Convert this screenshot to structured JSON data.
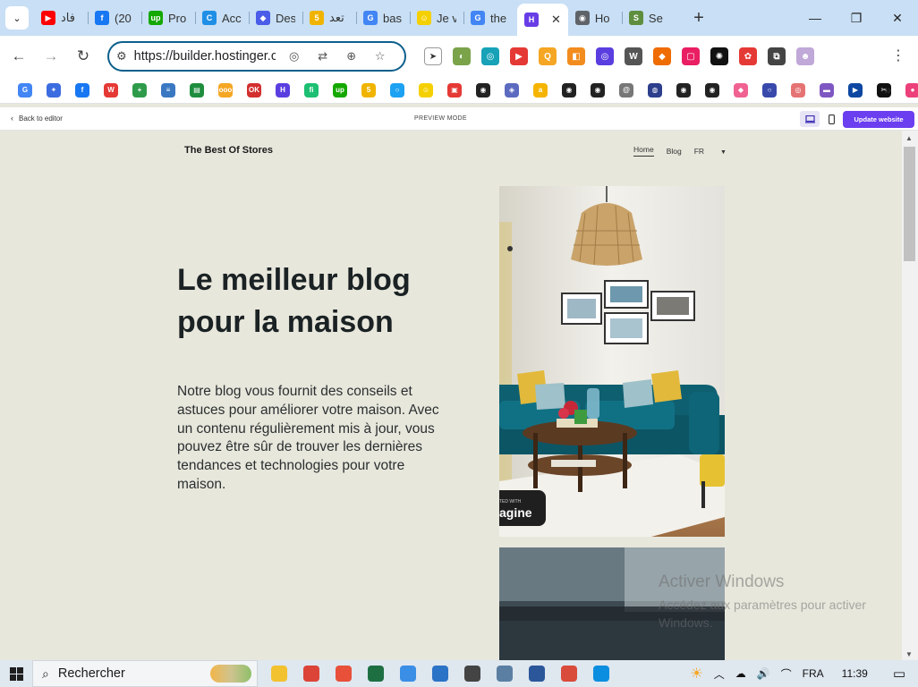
{
  "browser": {
    "tabs": [
      {
        "title": "فاد",
        "fav": "youtube-icon",
        "color": "#ff0000",
        "glyph": "▶"
      },
      {
        "title": "(20",
        "fav": "facebook-icon",
        "color": "#1877f2",
        "glyph": "f"
      },
      {
        "title": "Pro",
        "fav": "upwork-icon",
        "color": "#14a800",
        "glyph": "up"
      },
      {
        "title": "Acc",
        "fav": "canva-icon",
        "color": "#1f8fe6",
        "glyph": "C"
      },
      {
        "title": "Des",
        "fav": "designer-icon",
        "color": "#4a5ce8",
        "glyph": "◆"
      },
      {
        "title": "تعد",
        "fav": "five-icon",
        "color": "#f0b400",
        "glyph": "5"
      },
      {
        "title": "bas",
        "fav": "google-icon",
        "color": "#4285f4",
        "glyph": "G"
      },
      {
        "title": "Je v",
        "fav": "emoji-icon",
        "color": "#f5d000",
        "glyph": "☺"
      },
      {
        "title": "the",
        "fav": "google-icon",
        "color": "#4285f4",
        "glyph": "G"
      },
      {
        "title": "",
        "fav": "hostinger-icon",
        "color": "#673de6",
        "glyph": "H",
        "active": true
      },
      {
        "title": "Ho",
        "fav": "globe-icon",
        "color": "#5f6368",
        "glyph": "◉"
      },
      {
        "title": "Se",
        "fav": "shopify-icon",
        "color": "#5e8e3e",
        "glyph": "S"
      }
    ],
    "new_tab": "+",
    "window_controls": {
      "minimize": "—",
      "restore": "❐",
      "close": "✕"
    },
    "tab_search": "⌄"
  },
  "address_bar": {
    "url": "https://builder.hostinger.c",
    "back": "←",
    "forward": "→",
    "reload": "↻"
  },
  "extensions": [
    {
      "name": "cursor-ext-icon",
      "color": "#ffffff",
      "glyph": "➤",
      "outline": true
    },
    {
      "name": "glasses-ext-icon",
      "color": "#7aa34a",
      "glyph": "◐"
    },
    {
      "name": "robot-ext-icon",
      "color": "#17a2b8",
      "glyph": "◎"
    },
    {
      "name": "record-ext-icon",
      "color": "#e53935",
      "glyph": "▶"
    },
    {
      "name": "search-ext-icon",
      "color": "#f5a623",
      "glyph": "Q"
    },
    {
      "name": "box-ext-icon",
      "color": "#f28c1e",
      "glyph": "◧"
    },
    {
      "name": "ring-ext-icon",
      "color": "#5b3ee0",
      "glyph": "◎"
    },
    {
      "name": "w-ext-icon",
      "color": "#555555",
      "glyph": "W"
    },
    {
      "name": "fire-ext-icon",
      "color": "#ef6c00",
      "glyph": "◆"
    },
    {
      "name": "frame-ext-icon",
      "color": "#e91e63",
      "glyph": "▢"
    },
    {
      "name": "chatgpt-ext-icon",
      "color": "#111111",
      "glyph": "✺"
    },
    {
      "name": "spiral-ext-icon",
      "color": "#e53935",
      "glyph": "✿"
    },
    {
      "name": "puzzle-ext-icon",
      "color": "#444444",
      "glyph": "⧉"
    },
    {
      "name": "profile-avatar-icon",
      "color": "#c0a8d8",
      "glyph": "☻"
    }
  ],
  "bookmarks": [
    {
      "name": "google-bm-icon",
      "color": "#4285f4",
      "glyph": "G"
    },
    {
      "name": "gemini-bm-icon",
      "color": "#3b6ce0",
      "glyph": "✦"
    },
    {
      "name": "facebook-bm-icon",
      "color": "#1877f2",
      "glyph": "f"
    },
    {
      "name": "w-bm-icon",
      "color": "#e53935",
      "glyph": "W"
    },
    {
      "name": "plus-bm-icon",
      "color": "#2e9b4a",
      "glyph": "+"
    },
    {
      "name": "stats-bm-icon",
      "color": "#3a78c2",
      "glyph": "≡"
    },
    {
      "name": "sheet-bm-icon",
      "color": "#1e8e3e",
      "glyph": "▤"
    },
    {
      "name": "ooo-bm-icon",
      "color": "#f5a623",
      "glyph": "ooo"
    },
    {
      "name": "ok-bm-icon",
      "color": "#d32f2f",
      "glyph": "OK"
    },
    {
      "name": "hub-bm-icon",
      "color": "#5b3ee0",
      "glyph": "H"
    },
    {
      "name": "fiverr-bm-icon",
      "color": "#1dbf73",
      "glyph": "fi"
    },
    {
      "name": "upwork-bm-icon",
      "color": "#14a800",
      "glyph": "up"
    },
    {
      "name": "five-bm-icon",
      "color": "#f0b400",
      "glyph": "5"
    },
    {
      "name": "circle-bm-icon",
      "color": "#1da1f2",
      "glyph": "○"
    },
    {
      "name": "emoji-bm-icon",
      "color": "#f5d000",
      "glyph": "☺"
    },
    {
      "name": "gift-bm-icon",
      "color": "#e53935",
      "glyph": "▣"
    },
    {
      "name": "globe-bm-icon",
      "color": "#222222",
      "glyph": "◉"
    },
    {
      "name": "shield-bm-icon",
      "color": "#5c6bc0",
      "glyph": "◈"
    },
    {
      "name": "amazon-bm-icon",
      "color": "#f5b400",
      "glyph": "a"
    },
    {
      "name": "globe2-bm-icon",
      "color": "#222222",
      "glyph": "◉"
    },
    {
      "name": "globe3-bm-icon",
      "color": "#222222",
      "glyph": "◉"
    },
    {
      "name": "at-bm-icon",
      "color": "#777777",
      "glyph": "@"
    },
    {
      "name": "compass-bm-icon",
      "color": "#2c3e8c",
      "glyph": "◍"
    },
    {
      "name": "globe4-bm-icon",
      "color": "#222222",
      "glyph": "◉"
    },
    {
      "name": "globe5-bm-icon",
      "color": "#222222",
      "glyph": "◉"
    },
    {
      "name": "diamond-bm-icon",
      "color": "#f06292",
      "glyph": "◆"
    },
    {
      "name": "ring-bm-icon",
      "color": "#3949ab",
      "glyph": "○"
    },
    {
      "name": "target-bm-icon",
      "color": "#e57373",
      "glyph": "◎"
    },
    {
      "name": "flag-bm-icon",
      "color": "#7e57c2",
      "glyph": "▬"
    },
    {
      "name": "play-bm-icon",
      "color": "#0d47a1",
      "glyph": "▶"
    },
    {
      "name": "capcut-bm-icon",
      "color": "#111111",
      "glyph": "✂"
    },
    {
      "name": "blob-bm-icon",
      "color": "#ec407a",
      "glyph": "●"
    }
  ],
  "bookmarks_more": "»",
  "builder": {
    "back_label": "Back to editor",
    "preview_label": "PREVIEW MODE",
    "update_label": "Update website",
    "accent": "#6b3ef0"
  },
  "site": {
    "brand": "The Best Of  Stores",
    "nav": {
      "home": "Home",
      "blog": "Blog",
      "lang": "FR"
    },
    "hero_title": "Le meilleur blog pour la maison",
    "hero_body": "Notre blog vous fournit des conseils et astuces pour améliorer votre maison. Avec un contenu régulièrement mis à jour, vous pouvez être sûr de trouver les dernières tendances et technologies pour votre maison.",
    "badge_small": "TED WITH",
    "badge_big": "agine"
  },
  "watermark": {
    "line1": "Activer Windows",
    "line2": "Accédez aux paramètres pour activer",
    "line3": "Windows."
  },
  "taskbar": {
    "search_placeholder": "Rechercher",
    "apps": [
      {
        "name": "file-explorer-icon",
        "color": "#f2c230"
      },
      {
        "name": "chrome-taskbar-icon",
        "color": "#db4437"
      },
      {
        "name": "paint-icon",
        "color": "#e8503a"
      },
      {
        "name": "excel-icon",
        "color": "#1d6f42"
      },
      {
        "name": "notepad-icon",
        "color": "#3a8ee6"
      },
      {
        "name": "keyboard-icon",
        "color": "#2b73c7"
      },
      {
        "name": "calculator-icon",
        "color": "#444444"
      },
      {
        "name": "settings-taskbar-icon",
        "color": "#5b7fa3"
      },
      {
        "name": "word-icon",
        "color": "#2b579a"
      },
      {
        "name": "pen-app-icon",
        "color": "#d94b3a"
      },
      {
        "name": "edge-icon",
        "color": "#0c8ee0"
      }
    ],
    "tray": {
      "weather": "☀",
      "chevron": "︿",
      "cloud": "☁",
      "volume": "🔊",
      "wifi": "⌒",
      "lang": "FRA",
      "time": "11:39",
      "notif": "▭"
    }
  }
}
